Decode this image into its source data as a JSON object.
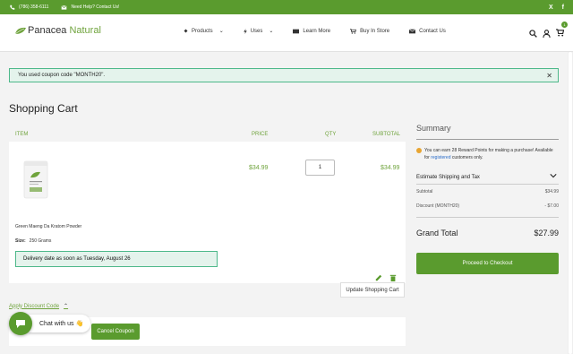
{
  "topbar": {
    "phone": "(786) 358-6111",
    "help": "Need Help? Contact Us!",
    "social": [
      "X",
      "f"
    ]
  },
  "header": {
    "logo_part1": "Panacea",
    "logo_part2": "Natural",
    "nav": [
      {
        "label": "Products",
        "icon": "products-icon",
        "has_dropdown": true
      },
      {
        "label": "Uses",
        "icon": "uses-icon",
        "has_dropdown": true
      },
      {
        "label": "Learn More",
        "icon": "book-icon",
        "has_dropdown": false
      },
      {
        "label": "Buy In Store",
        "icon": "store-icon",
        "has_dropdown": false
      },
      {
        "label": "Contact Us",
        "icon": "mail-icon",
        "has_dropdown": false
      }
    ],
    "cart_count": "1"
  },
  "notice": {
    "text": "You used coupon code \"MONTH20\"."
  },
  "page_title": "Shopping Cart",
  "cart": {
    "headers": {
      "item": "ITEM",
      "price": "PRICE",
      "qty": "QTY",
      "subtotal": "SUBTOTAL"
    },
    "item": {
      "name": "Green Maeng Da Kratom Powder",
      "size_label": "Size:",
      "size_value": "250 Grams",
      "price": "$34.99",
      "qty": "1",
      "subtotal": "$34.99",
      "delivery": "Delivery date as soon as Tuesday, August 26"
    },
    "update_button": "Update Shopping Cart"
  },
  "discount": {
    "link": "Apply Discount Code",
    "code_value": "MONTH20",
    "cancel_button": "Cancel Coupon"
  },
  "chat": {
    "label": "Chat with us 👋"
  },
  "summary": {
    "title": "Summary",
    "reward_text_1": "You can earn 28 Reward Points for making a purchase! Available for ",
    "reward_link": "registered",
    "reward_text_2": " customers only.",
    "shipping": "Estimate Shipping and Tax",
    "subtotal_label": "Subtotal",
    "subtotal_value": "$34.99",
    "discount_label": "Discount (MONTH20)",
    "discount_value": "- $7.00",
    "grand_total_label": "Grand Total",
    "grand_total_value": "$27.99",
    "checkout_button": "Proceed to Checkout"
  },
  "colors": {
    "brand_green": "#5a9b2e",
    "price_green": "#6fa33c",
    "notice_bg": "#e4f3ec",
    "notice_border": "#4db88a"
  }
}
